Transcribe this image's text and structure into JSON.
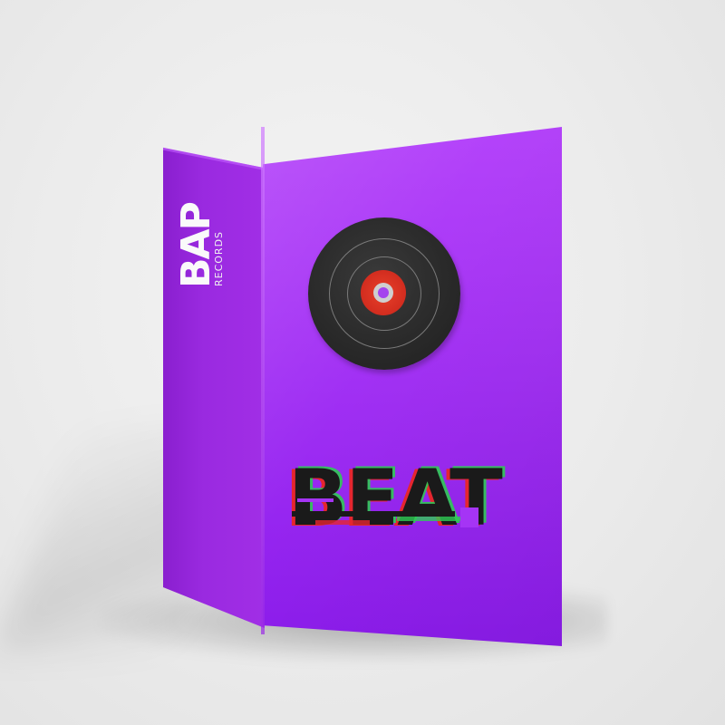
{
  "scene": {
    "description_type": "product box mockup",
    "colors": {
      "box_front": "#a534f5",
      "box_side": "#9a2ae0",
      "background": "#ebebeb",
      "record": "#2a2a2a",
      "record_label": "#d6301f",
      "title_text": "#1a1a1a",
      "glitch_red": "#e5262f",
      "glitch_green": "#2ecc54"
    }
  },
  "spine": {
    "logo_main": "BAP",
    "logo_sub": "RECORDS"
  },
  "front": {
    "title": "BEAT",
    "graphic": "vinyl-record-icon"
  }
}
